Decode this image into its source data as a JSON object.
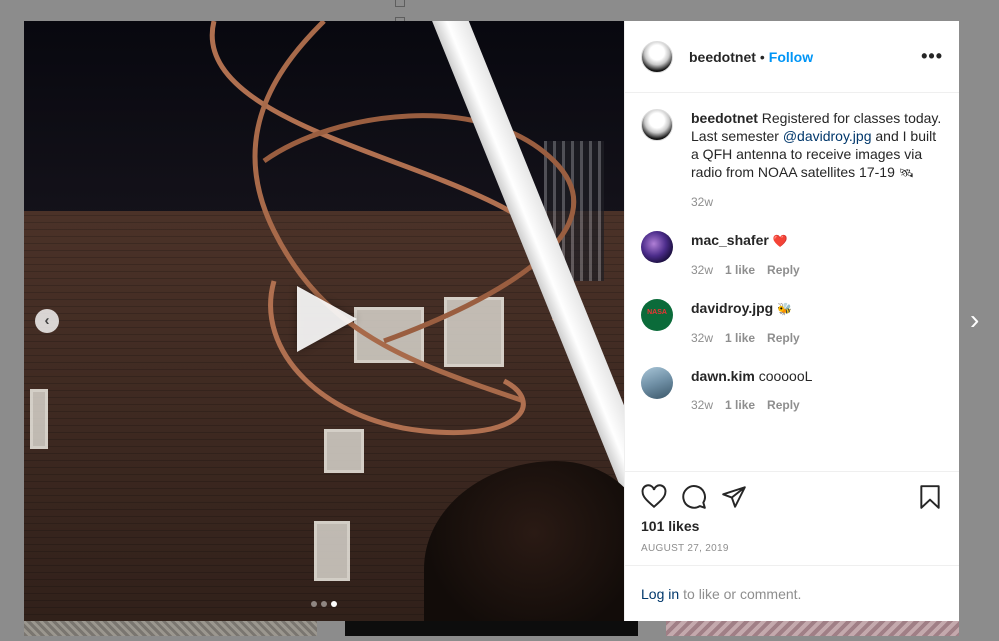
{
  "post": {
    "username": "beedotnet",
    "separator": "•",
    "follow_label": "Follow",
    "more_label": "•••",
    "caption_user": "beedotnet",
    "caption_text_1": " Registered for classes today. Last semester ",
    "caption_mention": "@davidroy.jpg",
    "caption_text_2": " and I built a QFH antenna to receive images via radio from NOAA satellites 17-19 ",
    "caption_emoji": "🛰",
    "caption_time": "32w",
    "likes": "101 likes",
    "date": "AUGUST 27, 2019"
  },
  "comments": [
    {
      "user": "mac_shafer",
      "text": "❤️",
      "time": "32w",
      "likes": "1 like",
      "reply": "Reply"
    },
    {
      "user": "davidroy.jpg",
      "text": "🐝",
      "time": "32w",
      "likes": "1 like",
      "reply": "Reply"
    },
    {
      "user": "dawn.kim",
      "text": "coooooL",
      "time": "32w",
      "likes": "1 like",
      "reply": "Reply"
    }
  ],
  "avatar_labels": {
    "nasa": "NASA"
  },
  "login": {
    "link": "Log in",
    "text": "to like or comment."
  },
  "media": {
    "current_slide": 3,
    "total_slides": 3
  },
  "nav": {
    "prev": "‹",
    "next": "›"
  },
  "colors": {
    "accent": "#0095f6",
    "mention": "#00376b",
    "muted": "#8e8e8e"
  }
}
